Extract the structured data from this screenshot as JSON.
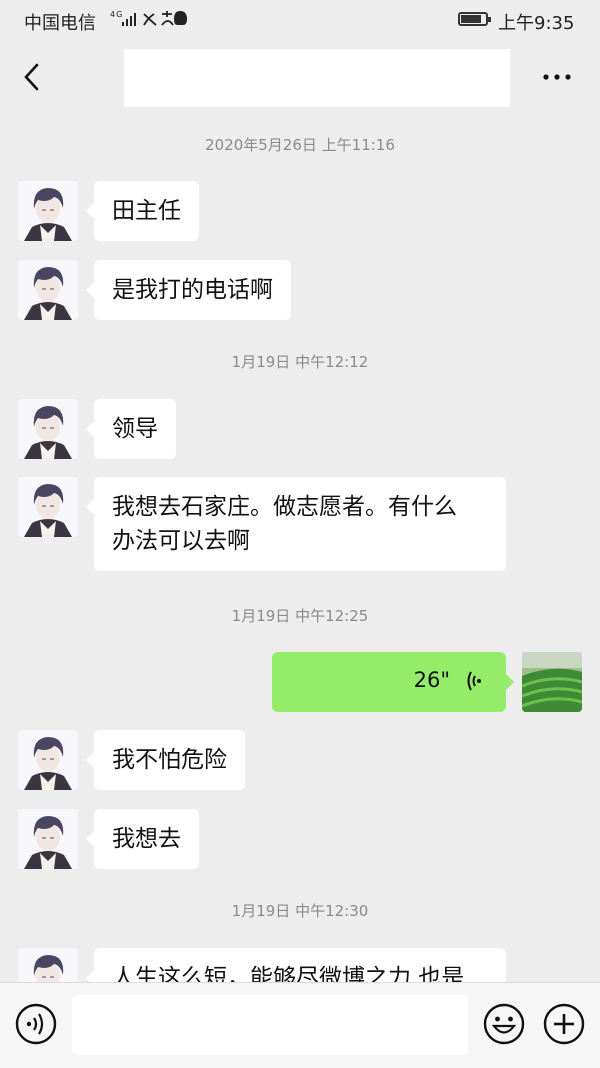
{
  "status_bar": {
    "carrier": "中国电信",
    "network": "4G",
    "icons": [
      "signal-icon",
      "missed-call-icon",
      "alipay-icon",
      "qq-icon",
      "battery-icon"
    ],
    "battery_level": 0.9,
    "time": "上午9:35"
  },
  "nav": {
    "title": "",
    "back_icon": "chevron-left-icon",
    "more_icon": "more-dots-icon"
  },
  "messages": {
    "ts1": "2020年5月26日 上午11:16",
    "m1": "田主任",
    "m2": "是我打的电话啊",
    "ts2": "1月19日 中午12:12",
    "m3": "领导",
    "m4a": "我想去石家庄。做志愿者。有什么",
    "m4b": "办法可以去啊",
    "ts3": "1月19日 中午12:25",
    "voice_duration": "26\"",
    "m5": "我不怕危险",
    "m6": "我想去",
    "ts4": "1月19日 中午12:30",
    "m7": "人生这么短，能够尽微博之力 也是"
  },
  "input_bar": {
    "text": "",
    "voice_icon": "voice-mode-icon",
    "emoji_icon": "emoji-icon",
    "plus_icon": "plus-icon"
  },
  "colors": {
    "background": "#ededed",
    "bubble_in": "#ffffff",
    "bubble_out": "#95ec69",
    "timestamp": "#8a8a8a"
  }
}
